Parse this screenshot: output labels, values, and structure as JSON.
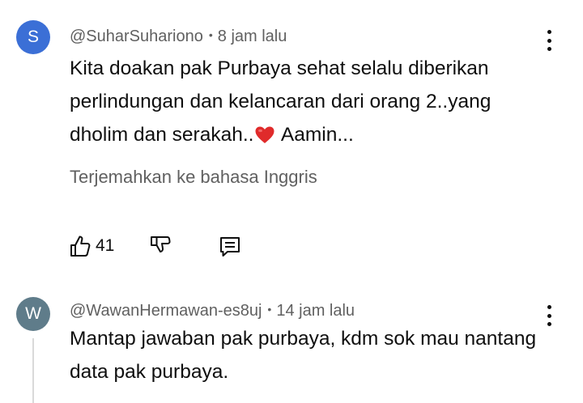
{
  "comments": [
    {
      "avatar_letter": "S",
      "avatar_color": "#3b6fd6",
      "username": "@SuharSuhariono",
      "time": "8 jam lalu",
      "text_part1": "Kita doakan pak Purbaya sehat selalu diberikan perlindungan dan kelancaran dari orang 2..yang dholim dan serakah..",
      "text_part2": " Aamin...",
      "translate_label": "Terjemahkan ke bahasa Inggris",
      "likes": "41"
    },
    {
      "avatar_letter": "W",
      "avatar_color": "#5f7c8a",
      "username": "@WawanHermawan-es8uj",
      "time": "14 jam lalu",
      "text": "Mantap jawaban pak purbaya, kdm sok mau nantang data pak purbaya."
    }
  ],
  "icons": {
    "separator": "•",
    "heart": "heart-emoji",
    "like": "thumbs-up-icon",
    "dislike": "thumbs-down-icon",
    "reply": "reply-icon",
    "more": "more-vert-icon"
  }
}
